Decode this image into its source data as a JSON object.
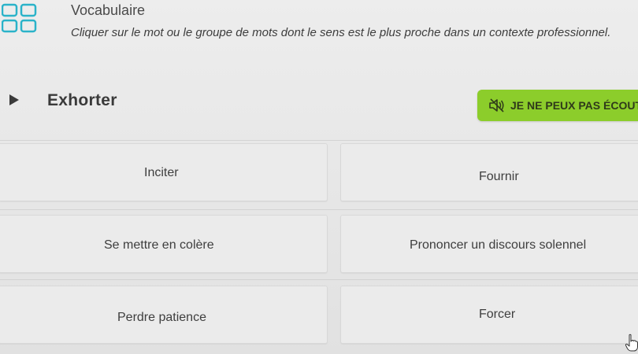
{
  "header": {
    "title": "Vocabulaire",
    "instruction": "Cliquer sur le mot ou le groupe de mots dont le sens est le plus proche dans un contexte professionnel."
  },
  "prompt": {
    "word": "Exhorter"
  },
  "audio": {
    "cant_listen_label": "JE NE PEUX PAS ÉCOUTE",
    "button_color": "#8ccd2b"
  },
  "options": [
    {
      "label": "Inciter"
    },
    {
      "label": "Fournir"
    },
    {
      "label": "Se mettre en colère"
    },
    {
      "label": "Prononcer un discours solennel"
    },
    {
      "label": "Perdre patience"
    },
    {
      "label": "Forcer"
    }
  ],
  "icons": {
    "header": "grid-icon",
    "play": "play-icon",
    "speaker": "speaker-muted-icon",
    "cursor": "hand-cursor-icon"
  }
}
